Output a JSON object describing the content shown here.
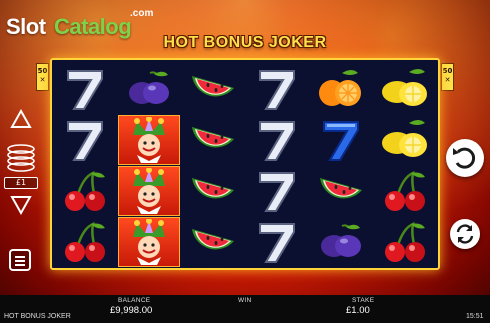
{
  "brand": {
    "slot": "Slot",
    "catalog": "Catalog",
    "dotcom": ".com"
  },
  "game": {
    "title": "HOT BONUS JOKER"
  },
  "side_badges": {
    "left": "50",
    "right": "50"
  },
  "bet_control": {
    "coin_value": "£1"
  },
  "bottom_bar": {
    "game_name": "HOT BONUS JOKER",
    "balance_label": "BALANCE",
    "balance_value": "£9,998.00",
    "win_label": "WIN",
    "win_value": "",
    "stake_label": "STAKE",
    "stake_value": "£1.00",
    "time": "15:51"
  },
  "reels": [
    [
      "seven-icon",
      "seven-icon",
      "cherry-icon",
      "cherry-icon"
    ],
    [
      "plum-icon",
      "joker-icon",
      "joker-icon",
      "joker-icon"
    ],
    [
      "watermelon-icon",
      "watermelon-icon",
      "watermelon-icon",
      "watermelon-icon"
    ],
    [
      "seven-icon",
      "seven-icon",
      "seven-icon",
      "seven-icon"
    ],
    [
      "orange-icon",
      "blue-seven-icon",
      "watermelon-icon",
      "plum-icon"
    ],
    [
      "lemon-icon",
      "lemon-icon",
      "cherry-icon",
      "cherry-icon"
    ]
  ],
  "colors": {
    "frame": "#ffd53a",
    "reel_bg": "#0c1030",
    "brand_green": "#7fd14a",
    "title_yellow": "#ffe04a"
  }
}
